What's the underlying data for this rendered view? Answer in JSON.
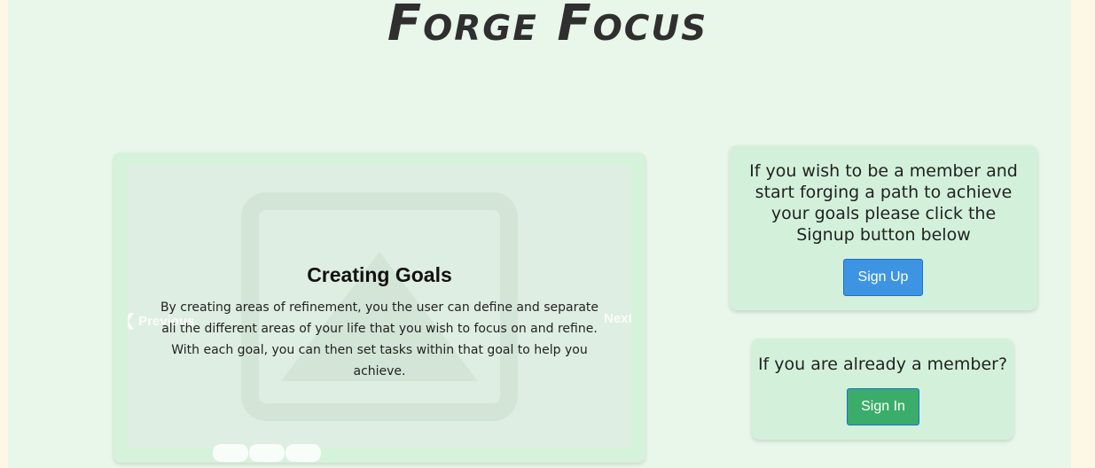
{
  "site": {
    "title": "Forge Focus"
  },
  "carousel": {
    "slide": {
      "title": "Creating Goals",
      "text": "By creating areas of refinement, you the user can define and separate all the different areas of your life that you wish to focus on and refine. With each goal, you can then set tasks within that goal to help you achieve."
    },
    "prev_label": "Previous",
    "next_label": "Next",
    "indicator_count": 3,
    "active_indicator": 1
  },
  "signup_card": {
    "text": "If you wish to be a member and start forging a path to achieve your goals please click the Signup button below",
    "button_label": "Sign Up",
    "button_color": "#3d94e3"
  },
  "signin_card": {
    "text": "If you are already a member?",
    "button_label": "Sign In",
    "button_color": "#3aad6a"
  },
  "colors": {
    "page_background": "#e8f7ea",
    "outer_background": "#fef7e6",
    "card_background": "#d3f1da"
  }
}
